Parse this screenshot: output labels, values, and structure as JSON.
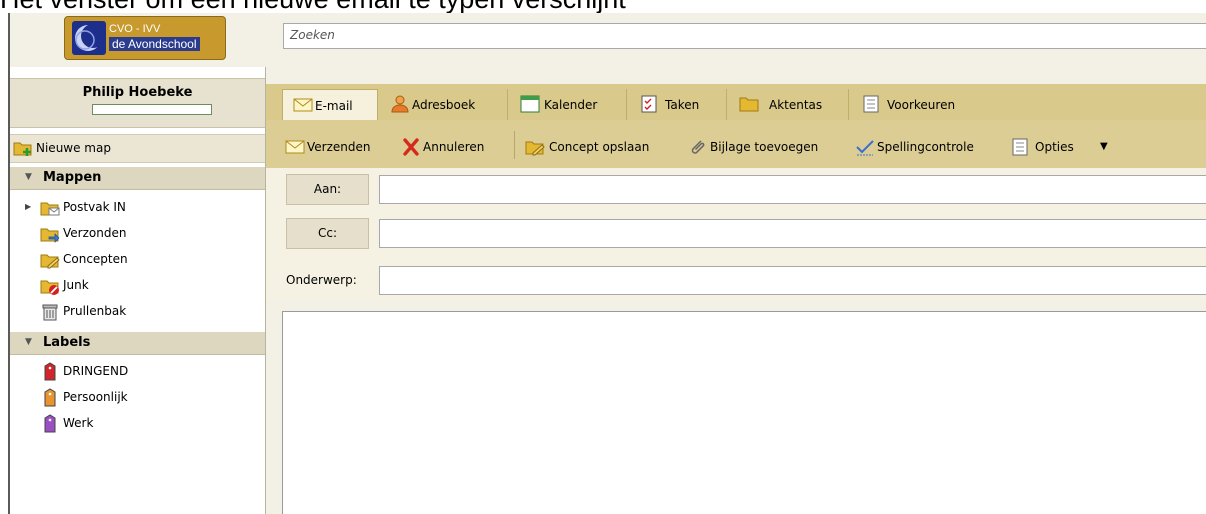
{
  "caption": "Het venster om een nieuwe email te typen verschijnt",
  "logo": {
    "line1": "CVO - IVV",
    "line2": "de Avondschool"
  },
  "search": {
    "placeholder": "Zoeken"
  },
  "user": {
    "name": "Philip Hoebeke",
    "quota_used_percent": 0
  },
  "sidebar": {
    "new_folder": "Nieuwe map",
    "folders_header": "Mappen",
    "folders": [
      {
        "label": "Postvak IN",
        "icon": "inbox-folder-icon"
      },
      {
        "label": "Verzonden",
        "icon": "sent-folder-icon"
      },
      {
        "label": "Concepten",
        "icon": "drafts-folder-icon"
      },
      {
        "label": "Junk",
        "icon": "junk-folder-icon"
      },
      {
        "label": "Prullenbak",
        "icon": "trash-icon"
      }
    ],
    "labels_header": "Labels",
    "labels": [
      {
        "label": "DRINGEND",
        "color": "#d0262b"
      },
      {
        "label": "Persoonlijk",
        "color": "#e89430"
      },
      {
        "label": "Werk",
        "color": "#9a4fc2"
      }
    ]
  },
  "tabs": [
    {
      "label": "E-mail",
      "icon": "envelope-icon",
      "active": true
    },
    {
      "label": "Adresboek",
      "icon": "contacts-icon"
    },
    {
      "label": "Kalender",
      "icon": "calendar-icon"
    },
    {
      "label": "Taken",
      "icon": "tasks-icon"
    },
    {
      "label": "Aktentas",
      "icon": "briefcase-folder-icon"
    },
    {
      "label": "Voorkeuren",
      "icon": "preferences-icon"
    }
  ],
  "toolbar": {
    "send": "Verzenden",
    "cancel": "Annuleren",
    "save_draft": "Concept opslaan",
    "add_attachment": "Bijlage toevoegen",
    "spellcheck": "Spellingcontrole",
    "options": "Opties"
  },
  "compose": {
    "to_label": "Aan:",
    "cc_label": "Cc:",
    "subject_label": "Onderwerp:",
    "to_value": "",
    "cc_value": "",
    "subject_value": "",
    "body_value": ""
  }
}
